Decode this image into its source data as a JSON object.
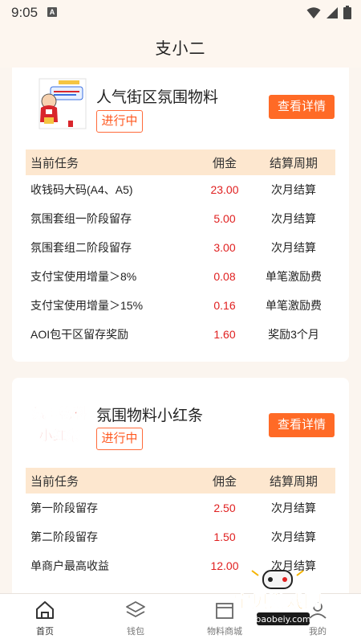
{
  "status_bar": {
    "time": "9:05",
    "a_badge": "A"
  },
  "app": {
    "title": "支小二"
  },
  "campaigns": [
    {
      "title": "人气街区氛围物料",
      "status": "进行中",
      "detail_button": "查看详情",
      "thumb_icon": "character-poster-icon",
      "headers": {
        "task": "当前任务",
        "commission": "佣金",
        "settlement": "结算周期"
      },
      "tasks": [
        {
          "name": "收钱码大码(A4、A5)",
          "commission": "23.00",
          "settlement": "次月结算"
        },
        {
          "name": "氛围套组一阶段留存",
          "commission": "5.00",
          "settlement": "次月结算"
        },
        {
          "name": "氛围套组二阶段留存",
          "commission": "3.00",
          "settlement": "次月结算"
        },
        {
          "name": "支付宝使用增量＞8%",
          "commission": "0.08",
          "settlement": "单笔激励费"
        },
        {
          "name": "支付宝使用增量＞15%",
          "commission": "0.16",
          "settlement": "单笔激励费"
        },
        {
          "name": "AOI包干区留存奖励",
          "commission": "1.60",
          "settlement": "奖励3个月"
        }
      ]
    },
    {
      "title": "氛围物料小红条",
      "status": "进行中",
      "detail_button": "查看详情",
      "thumb_text_line1": "氛围物料",
      "thumb_text_line2": "小红条",
      "headers": {
        "task": "当前任务",
        "commission": "佣金",
        "settlement": "结算周期"
      },
      "tasks": [
        {
          "name": "第一阶段留存",
          "commission": "2.50",
          "settlement": "次月结算"
        },
        {
          "name": "第二阶段留存",
          "commission": "1.50",
          "settlement": "次月结算"
        },
        {
          "name": "单商户最高收益",
          "commission": "12.00",
          "settlement": "次月结算"
        }
      ]
    }
  ],
  "bottom_nav": [
    {
      "label": "首页",
      "icon": "home-icon",
      "active": true
    },
    {
      "label": "钱包",
      "icon": "layers-icon",
      "active": false
    },
    {
      "label": "物料商城",
      "icon": "store-icon",
      "active": false
    },
    {
      "label": "我的",
      "icon": "profile-icon",
      "active": false
    }
  ],
  "watermark": {
    "text": "宝贝游戏网",
    "url": "baobeiy.com"
  },
  "colors": {
    "accent": "#ff6a26",
    "commission": "#e02020",
    "table_header": "#fde7cf",
    "page_bg": "#fbf5ef"
  }
}
